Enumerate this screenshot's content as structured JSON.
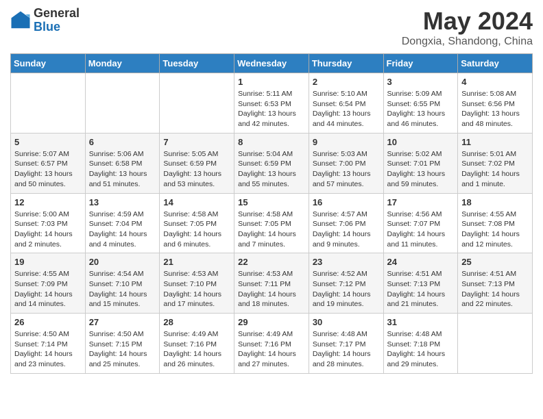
{
  "header": {
    "logo_general": "General",
    "logo_blue": "Blue",
    "main_title": "May 2024",
    "subtitle": "Dongxia, Shandong, China"
  },
  "calendar": {
    "days_of_week": [
      "Sunday",
      "Monday",
      "Tuesday",
      "Wednesday",
      "Thursday",
      "Friday",
      "Saturday"
    ],
    "weeks": [
      [
        null,
        null,
        null,
        {
          "day": "1",
          "sunrise": "5:11 AM",
          "sunset": "6:53 PM",
          "daylight": "13 hours and 42 minutes."
        },
        {
          "day": "2",
          "sunrise": "5:10 AM",
          "sunset": "6:54 PM",
          "daylight": "13 hours and 44 minutes."
        },
        {
          "day": "3",
          "sunrise": "5:09 AM",
          "sunset": "6:55 PM",
          "daylight": "13 hours and 46 minutes."
        },
        {
          "day": "4",
          "sunrise": "5:08 AM",
          "sunset": "6:56 PM",
          "daylight": "13 hours and 48 minutes."
        }
      ],
      [
        {
          "day": "5",
          "sunrise": "5:07 AM",
          "sunset": "6:57 PM",
          "daylight": "13 hours and 50 minutes."
        },
        {
          "day": "6",
          "sunrise": "5:06 AM",
          "sunset": "6:58 PM",
          "daylight": "13 hours and 51 minutes."
        },
        {
          "day": "7",
          "sunrise": "5:05 AM",
          "sunset": "6:59 PM",
          "daylight": "13 hours and 53 minutes."
        },
        {
          "day": "8",
          "sunrise": "5:04 AM",
          "sunset": "6:59 PM",
          "daylight": "13 hours and 55 minutes."
        },
        {
          "day": "9",
          "sunrise": "5:03 AM",
          "sunset": "7:00 PM",
          "daylight": "13 hours and 57 minutes."
        },
        {
          "day": "10",
          "sunrise": "5:02 AM",
          "sunset": "7:01 PM",
          "daylight": "13 hours and 59 minutes."
        },
        {
          "day": "11",
          "sunrise": "5:01 AM",
          "sunset": "7:02 PM",
          "daylight": "14 hours and 1 minute."
        }
      ],
      [
        {
          "day": "12",
          "sunrise": "5:00 AM",
          "sunset": "7:03 PM",
          "daylight": "14 hours and 2 minutes."
        },
        {
          "day": "13",
          "sunrise": "4:59 AM",
          "sunset": "7:04 PM",
          "daylight": "14 hours and 4 minutes."
        },
        {
          "day": "14",
          "sunrise": "4:58 AM",
          "sunset": "7:05 PM",
          "daylight": "14 hours and 6 minutes."
        },
        {
          "day": "15",
          "sunrise": "4:58 AM",
          "sunset": "7:05 PM",
          "daylight": "14 hours and 7 minutes."
        },
        {
          "day": "16",
          "sunrise": "4:57 AM",
          "sunset": "7:06 PM",
          "daylight": "14 hours and 9 minutes."
        },
        {
          "day": "17",
          "sunrise": "4:56 AM",
          "sunset": "7:07 PM",
          "daylight": "14 hours and 11 minutes."
        },
        {
          "day": "18",
          "sunrise": "4:55 AM",
          "sunset": "7:08 PM",
          "daylight": "14 hours and 12 minutes."
        }
      ],
      [
        {
          "day": "19",
          "sunrise": "4:55 AM",
          "sunset": "7:09 PM",
          "daylight": "14 hours and 14 minutes."
        },
        {
          "day": "20",
          "sunrise": "4:54 AM",
          "sunset": "7:10 PM",
          "daylight": "14 hours and 15 minutes."
        },
        {
          "day": "21",
          "sunrise": "4:53 AM",
          "sunset": "7:10 PM",
          "daylight": "14 hours and 17 minutes."
        },
        {
          "day": "22",
          "sunrise": "4:53 AM",
          "sunset": "7:11 PM",
          "daylight": "14 hours and 18 minutes."
        },
        {
          "day": "23",
          "sunrise": "4:52 AM",
          "sunset": "7:12 PM",
          "daylight": "14 hours and 19 minutes."
        },
        {
          "day": "24",
          "sunrise": "4:51 AM",
          "sunset": "7:13 PM",
          "daylight": "14 hours and 21 minutes."
        },
        {
          "day": "25",
          "sunrise": "4:51 AM",
          "sunset": "7:13 PM",
          "daylight": "14 hours and 22 minutes."
        }
      ],
      [
        {
          "day": "26",
          "sunrise": "4:50 AM",
          "sunset": "7:14 PM",
          "daylight": "14 hours and 23 minutes."
        },
        {
          "day": "27",
          "sunrise": "4:50 AM",
          "sunset": "7:15 PM",
          "daylight": "14 hours and 25 minutes."
        },
        {
          "day": "28",
          "sunrise": "4:49 AM",
          "sunset": "7:16 PM",
          "daylight": "14 hours and 26 minutes."
        },
        {
          "day": "29",
          "sunrise": "4:49 AM",
          "sunset": "7:16 PM",
          "daylight": "14 hours and 27 minutes."
        },
        {
          "day": "30",
          "sunrise": "4:48 AM",
          "sunset": "7:17 PM",
          "daylight": "14 hours and 28 minutes."
        },
        {
          "day": "31",
          "sunrise": "4:48 AM",
          "sunset": "7:18 PM",
          "daylight": "14 hours and 29 minutes."
        },
        null
      ]
    ]
  }
}
